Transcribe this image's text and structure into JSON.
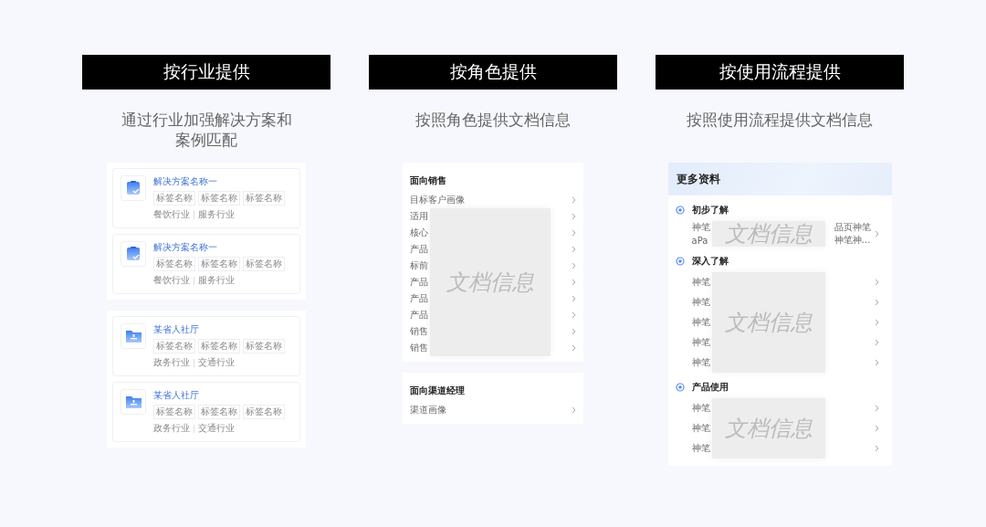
{
  "columns": [
    {
      "kind": "cards",
      "header": "按行业提供",
      "subtitle": [
        "通过行业加强解决方案和",
        "案例匹配"
      ],
      "groups": [
        {
          "cards": [
            {
              "kind": "clipboard",
              "title": "解决方案名称一",
              "tags": [
                "标签名称",
                "标签名称",
                "标签名称"
              ],
              "industries": [
                "餐饮行业",
                "服务行业"
              ]
            },
            {
              "kind": "clipboard",
              "title": "解决方案名称一",
              "tags": [
                "标签名称",
                "标签名称",
                "标签名称"
              ],
              "industries": [
                "餐饮行业",
                "服务行业"
              ]
            }
          ]
        },
        {
          "cards": [
            {
              "kind": "folder",
              "title": "某省人社厅",
              "tags": [
                "标签名称",
                "标签名称",
                "标签名称"
              ],
              "industries": [
                "政务行业",
                "交通行业"
              ]
            },
            {
              "kind": "folder",
              "title": "某省人社厅",
              "tags": [
                "标签名称",
                "标签名称",
                "标签名称"
              ],
              "industries": [
                "政务行业",
                "交通行业"
              ]
            }
          ]
        }
      ]
    },
    {
      "kind": "menu",
      "header": "按角色提供",
      "subtitle": [
        "按照角色提供文档信息"
      ],
      "sections": [
        {
          "title": "面向销售",
          "overlay": "文档信息",
          "items": [
            "目标客户画像",
            "适用",
            "核心",
            "产品",
            "标前",
            "产品",
            "产品",
            "产品",
            "销售",
            "销售"
          ]
        },
        {
          "title": "面向渠道经理",
          "items": [
            "渠道画像"
          ]
        }
      ]
    },
    {
      "kind": "timeline",
      "header": "按使用流程提供",
      "subtitle": [
        "按照使用流程提供文档信息"
      ],
      "panel_title": "更多资料",
      "sections": [
        {
          "title": "初步了解",
          "overlay": "文档信息",
          "items": [
            {
              "lines": [
                {
                  "start": "神笔",
                  "end": "品页神笔"
                },
                {
                  "start": "aPa",
                  "end": "神笔神…"
                }
              ]
            }
          ]
        },
        {
          "title": "深入了解",
          "overlay": "文档信息",
          "items": [
            {
              "lines": [
                {
                  "start": "神笔"
                }
              ]
            },
            {
              "lines": [
                {
                  "start": "神笔"
                }
              ]
            },
            {
              "lines": [
                {
                  "start": "神笔"
                }
              ]
            },
            {
              "lines": [
                {
                  "start": "神笔"
                }
              ]
            },
            {
              "lines": [
                {
                  "start": "神笔"
                }
              ]
            }
          ]
        },
        {
          "title": "产品使用",
          "overlay": "文档信息",
          "items": [
            {
              "lines": [
                {
                  "start": "神笔"
                }
              ]
            },
            {
              "lines": [
                {
                  "start": "神笔"
                }
              ]
            },
            {
              "lines": [
                {
                  "start": "神笔"
                }
              ]
            }
          ]
        }
      ]
    }
  ]
}
